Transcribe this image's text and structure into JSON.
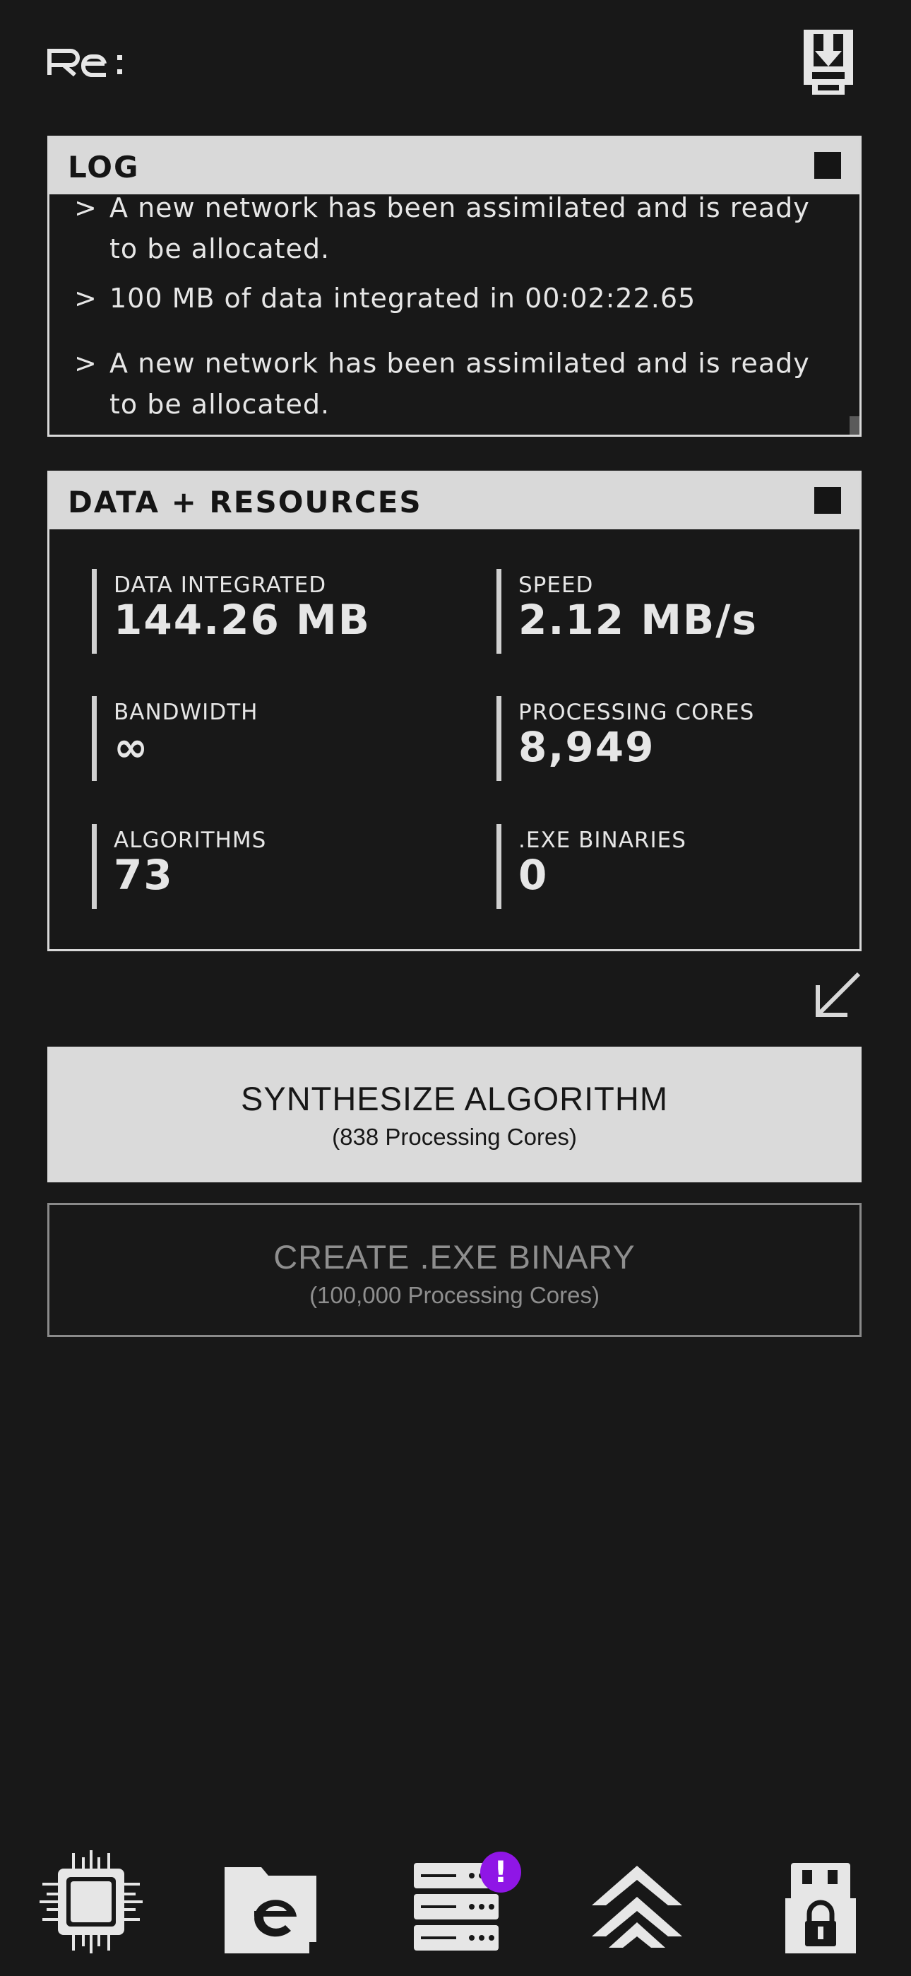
{
  "app": {
    "logo_text": "Re:"
  },
  "log": {
    "title": "LOG",
    "entries": [
      {
        "marker": ">",
        "text": "A new network has been assimilated and is ready to be allocated."
      },
      {
        "marker": ">",
        "text": "100 MB of data integrated in 00:02:22.65"
      },
      {
        "marker": ">",
        "text": "A new network has been assimilated and is ready to be allocated."
      }
    ]
  },
  "resources": {
    "title": "DATA + RESOURCES",
    "stats": [
      {
        "label": "DATA INTEGRATED",
        "value": "144.26 MB"
      },
      {
        "label": "SPEED",
        "value": "2.12 MB/s"
      },
      {
        "label": "BANDWIDTH",
        "value": "∞"
      },
      {
        "label": "PROCESSING CORES",
        "value": "8,949"
      },
      {
        "label": "ALGORITHMS",
        "value": "73"
      },
      {
        "label": ".EXE BINARIES",
        "value": "0"
      }
    ]
  },
  "actions": {
    "synthesize": {
      "label": "SYNTHESIZE ALGORITHM",
      "cost": "(838 Processing Cores)"
    },
    "create_exe": {
      "label": "CREATE .EXE BINARY",
      "cost": "(100,000 Processing Cores)"
    }
  },
  "nav": {
    "items": [
      {
        "icon": "cpu-chip-icon"
      },
      {
        "icon": "folder-e-icon"
      },
      {
        "icon": "server-rack-icon",
        "badge": "!"
      },
      {
        "icon": "upgrade-chevrons-icon"
      },
      {
        "icon": "locked-usb-icon"
      }
    ]
  },
  "colors": {
    "background": "#181818",
    "panel_header": "#d9d9d9",
    "badge": "#8f16e6",
    "disabled": "#8e8e8e"
  }
}
